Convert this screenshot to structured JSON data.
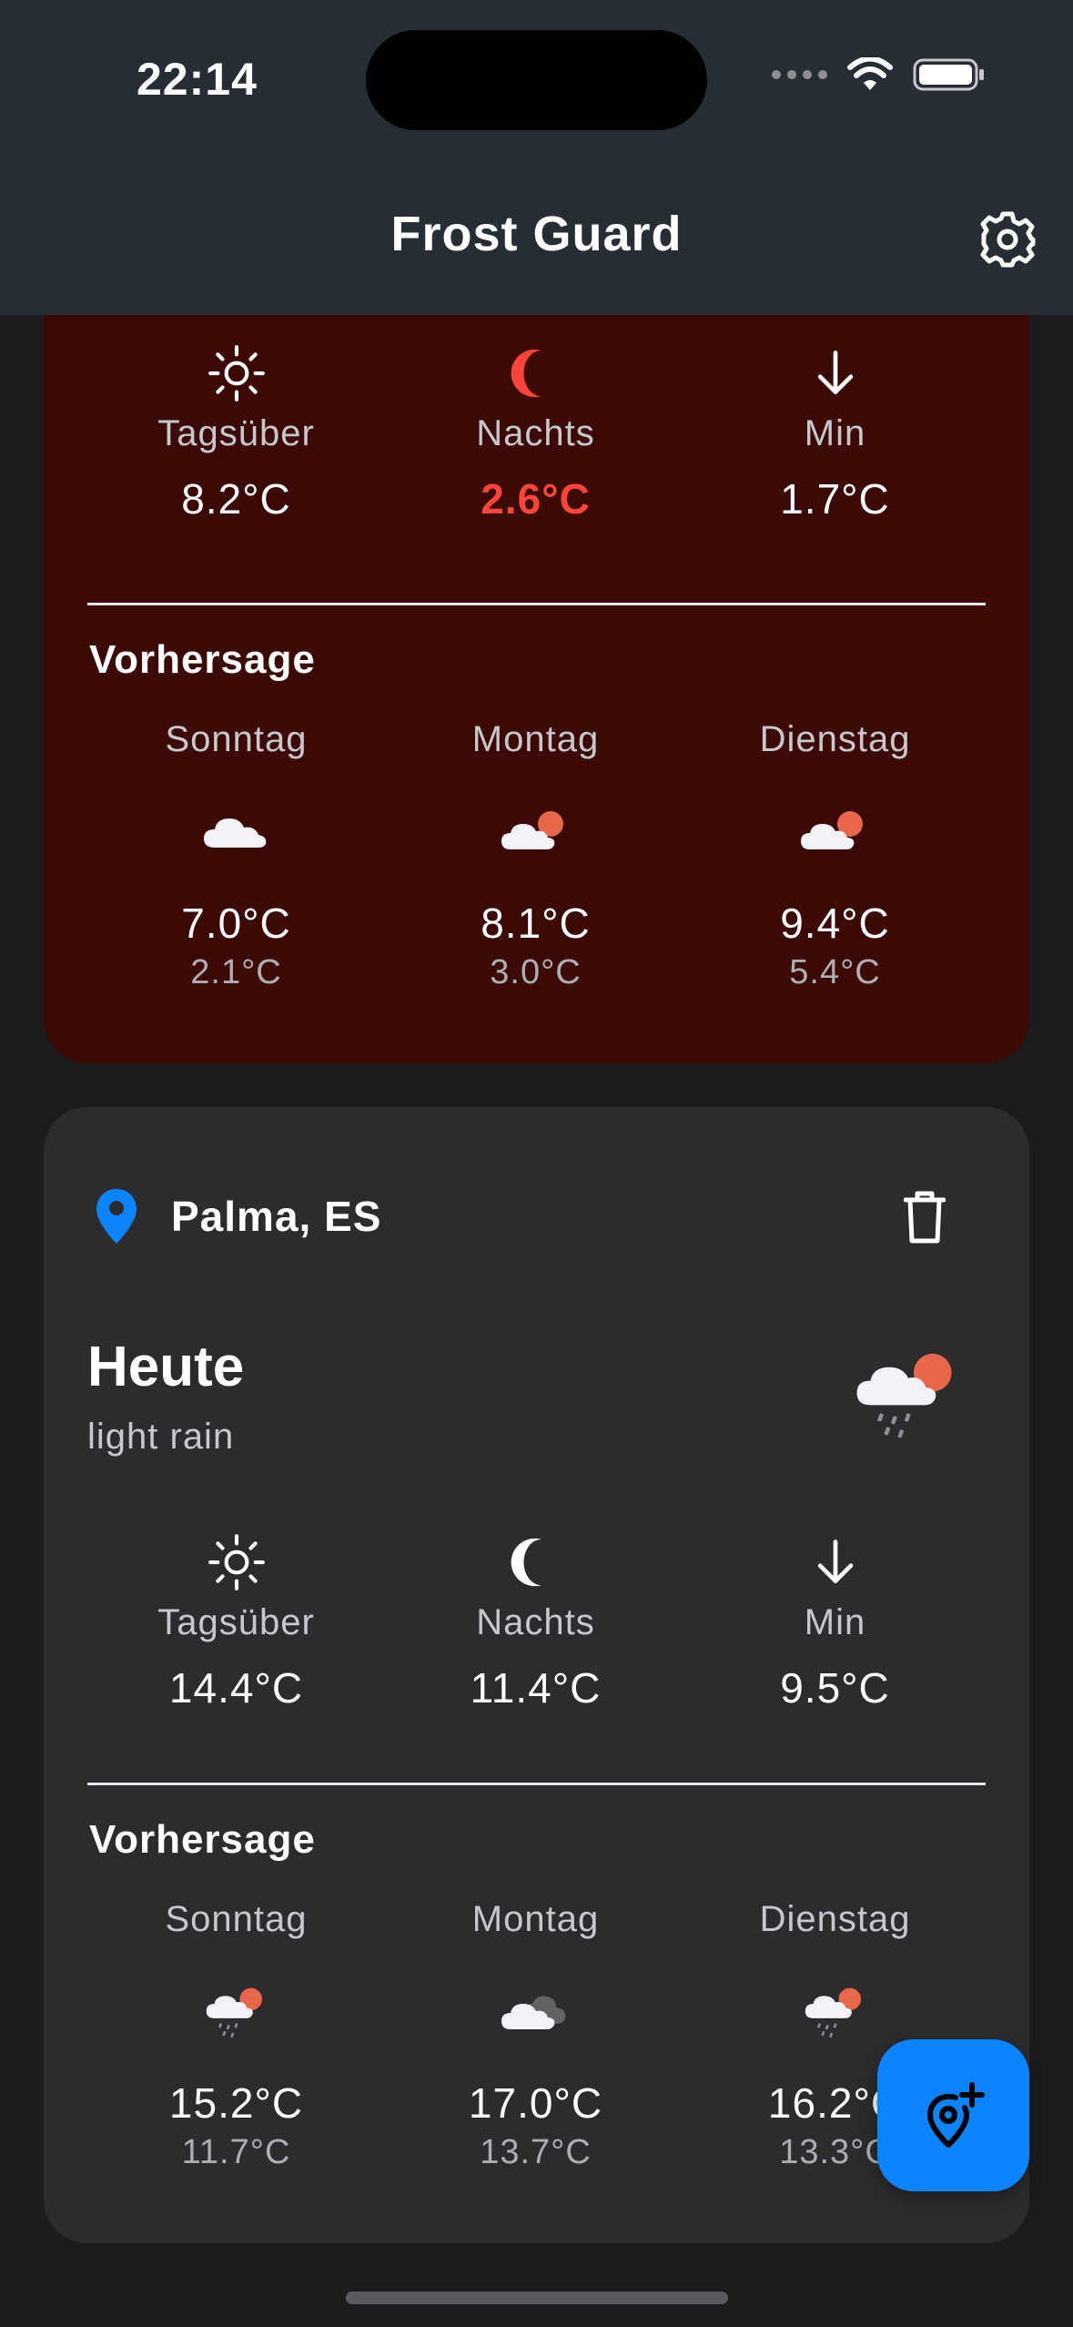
{
  "status_bar": {
    "time": "22:14"
  },
  "app": {
    "title": "Frost Guard"
  },
  "icons": {
    "settings": "gear-icon",
    "location": "location-pin-icon",
    "delete": "trash-icon",
    "add_location": "add-location-icon"
  },
  "colors": {
    "frost_card_bg": "#3b0a06",
    "card_bg": "#2c2c2e",
    "alert": "#ff453a",
    "accent": "#0a84ff",
    "header_bg": "#262d35"
  },
  "frost_card": {
    "metrics": [
      {
        "icon": "sun-icon",
        "label": "Tagsüber",
        "value": "8.2°C",
        "alert": false
      },
      {
        "icon": "moon-icon",
        "label": "Nachts",
        "value": "2.6°C",
        "alert": true
      },
      {
        "icon": "arrow-down-icon",
        "label": "Min",
        "value": "1.7°C",
        "alert": false
      }
    ],
    "forecast_title": "Vorhersage",
    "forecast": [
      {
        "day": "Sonntag",
        "icon": "cloud-icon",
        "high": "7.0°C",
        "low": "2.1°C"
      },
      {
        "day": "Montag",
        "icon": "partly-cloudy-icon",
        "high": "8.1°C",
        "low": "3.0°C"
      },
      {
        "day": "Dienstag",
        "icon": "partly-cloudy-icon",
        "high": "9.4°C",
        "low": "5.4°C"
      }
    ]
  },
  "palma_card": {
    "location": "Palma, ES",
    "today_label": "Heute",
    "description": "light rain",
    "today_icon": "light-rain-icon",
    "metrics": [
      {
        "icon": "sun-icon",
        "label": "Tagsüber",
        "value": "14.4°C",
        "alert": false
      },
      {
        "icon": "moon-icon",
        "label": "Nachts",
        "value": "11.4°C",
        "alert": false
      },
      {
        "icon": "arrow-down-icon",
        "label": "Min",
        "value": "9.5°C",
        "alert": false
      }
    ],
    "forecast_title": "Vorhersage",
    "forecast": [
      {
        "day": "Sonntag",
        "icon": "light-rain-icon",
        "high": "15.2°C",
        "low": "11.7°C"
      },
      {
        "day": "Montag",
        "icon": "overcast-icon",
        "high": "17.0°C",
        "low": "13.7°C"
      },
      {
        "day": "Dienstag",
        "icon": "light-rain-icon",
        "high": "16.2°C",
        "low": "13.3°C"
      }
    ]
  }
}
